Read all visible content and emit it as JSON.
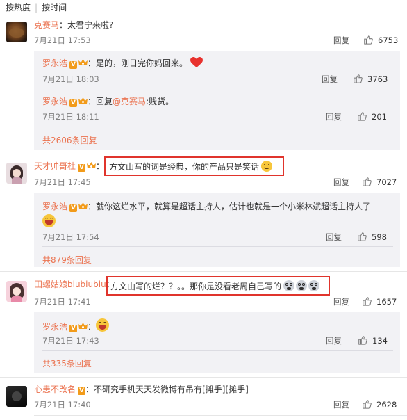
{
  "tabs": {
    "hot": "按热度",
    "time": "按时间"
  },
  "labels": {
    "reply": "回复"
  },
  "comments": [
    {
      "user": "克赛马",
      "text": "太君宁来啦?",
      "time": "7月21日 17:53",
      "likes": "6753"
    },
    {
      "user": "天才帅哥杜",
      "text": "方文山写的词是经典，你的产品只是笑话",
      "time": "7月21日 17:45",
      "likes": "7027"
    },
    {
      "user": "田螺姑娘biubiubiu",
      "text": "方文山写的烂？？。。那你是没看老周自己写的",
      "time": "7月21日 17:41",
      "likes": "1657"
    },
    {
      "user": "心患不改名",
      "text": "不研究手机天天发微博有吊有[摊手][摊手]",
      "time": "7月21日 17:40",
      "likes": "2628"
    }
  ],
  "replies": [
    {
      "user": "罗永浩",
      "text": "是的，刚日完你妈回来。",
      "time": "7月21日 18:03",
      "likes": "3763"
    },
    {
      "user": "罗永浩",
      "prefix": "回复",
      "mention": "@克赛马",
      "text": ":贱货。",
      "time": "7月21日 18:11",
      "likes": "201"
    },
    {
      "user": "罗永浩",
      "text": "就你这烂水平，就算是超话主持人，估计也就是一个小米林斌超话主持人了",
      "time": "7月21日 17:54",
      "likes": "598"
    },
    {
      "user": "罗永浩",
      "text": "",
      "time": "7月21日 17:43",
      "likes": "134"
    }
  ],
  "more": [
    "共2606条回复",
    "共879条回复",
    "共335条回复"
  ]
}
